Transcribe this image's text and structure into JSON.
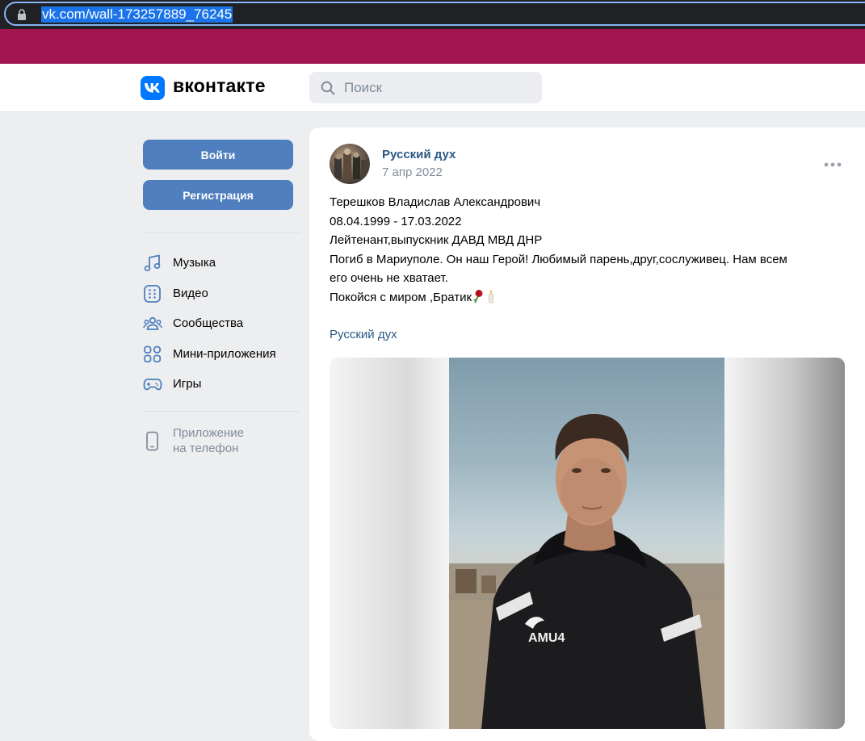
{
  "browser": {
    "url": "vk.com/wall-173257889_76245"
  },
  "header": {
    "logo_text": "вконтакте",
    "search_placeholder": "Поиск"
  },
  "sidebar": {
    "login_label": "Войти",
    "register_label": "Регистрация",
    "items": [
      {
        "label": "Музыка",
        "icon": "music-icon"
      },
      {
        "label": "Видео",
        "icon": "video-icon"
      },
      {
        "label": "Сообщества",
        "icon": "communities-icon"
      },
      {
        "label": "Мини-приложения",
        "icon": "mini-apps-icon"
      },
      {
        "label": "Игры",
        "icon": "games-icon"
      }
    ],
    "app_line1": "Приложение",
    "app_line2": "на телефон"
  },
  "post": {
    "author": "Русский дух",
    "date": "7 апр 2022",
    "lines": [
      "Терешков Владислав Александрович",
      "08.04.1999 - 17.03.2022",
      "Лейтенант,выпускник ДАВД МВД ДНР",
      "Погиб в Мариуполе. Он наш Герой! Любимый парень,друг,сослуживец. Нам всем",
      "его очень не хватает.",
      "Покойся с миром ,Братик"
    ],
    "repost_source": "Русский дух",
    "photo_print_text": "AMU4"
  },
  "colors": {
    "accent": "#4f7fbf",
    "brand": "#0077ff",
    "link": "#2a5885",
    "band": "#a3154e"
  }
}
